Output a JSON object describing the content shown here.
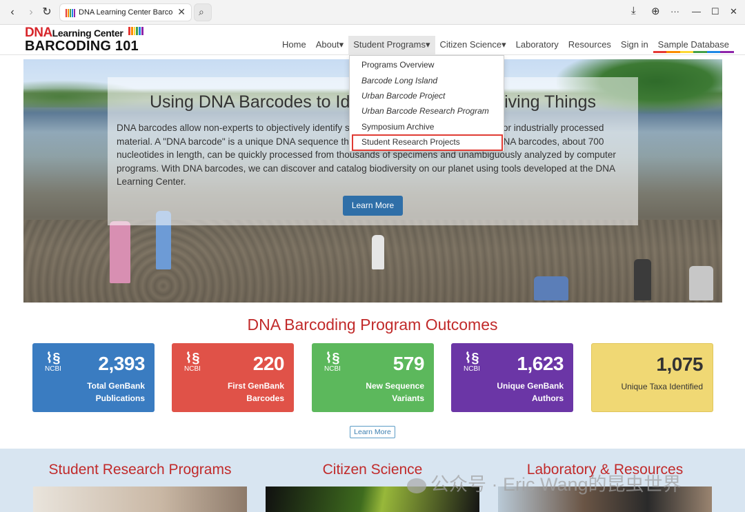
{
  "browser": {
    "tab_title": "DNA Learning Center Barco",
    "close_glyph": "✕",
    "back_glyph": "‹",
    "forward_glyph": "›",
    "reload_glyph": "↻",
    "search_glyph": "⌕",
    "download_glyph": "⤓",
    "globe_glyph": "⊕",
    "more_glyph": "···",
    "minimize_glyph": "—",
    "maximize_glyph": "☐",
    "window_close_glyph": "✕"
  },
  "logo": {
    "top": "DNA",
    "top_sub": "Learning Center",
    "bottom": "BARCODING 101",
    "bar_colors": [
      "#e53935",
      "#fb8c00",
      "#fdd835",
      "#43a047",
      "#1e88e5",
      "#8e24aa"
    ]
  },
  "nav": {
    "items": [
      {
        "label": "Home"
      },
      {
        "label": "About▾"
      },
      {
        "label": "Student Programs▾"
      },
      {
        "label": "Citizen Science▾"
      },
      {
        "label": "Laboratory"
      },
      {
        "label": "Resources"
      },
      {
        "label": "Sign in"
      },
      {
        "label": "Sample Database"
      }
    ]
  },
  "dropdown": {
    "items": [
      {
        "label": "Programs Overview",
        "italic": false
      },
      {
        "label": "Barcode Long Island",
        "italic": true
      },
      {
        "label": "Urban Barcode Project",
        "italic": true
      },
      {
        "label": "Urban Barcode Research Program",
        "italic": true
      },
      {
        "label": "Symposium Archive",
        "italic": false
      },
      {
        "label": "Student Research Projects",
        "italic": false
      }
    ],
    "highlight_color": "#e03b33"
  },
  "hero": {
    "title": "Using DNA Barcodes to Identify and Classify Living Things",
    "text": "DNA barcodes allow non-experts to objectively identify species – even from small, damaged, or industrially processed material. A \"DNA barcode\" is a unique DNA sequence that identifies each living thing. Short DNA barcodes, about 700 nucleotides in length, can be quickly processed from thousands of specimens and unambiguously analyzed by computer programs. With DNA barcodes, we can discover and catalog biodiversity on our planet using tools developed at the DNA Learning Center.",
    "button": "Learn More"
  },
  "outcomes": {
    "title": "DNA Barcoding Program Outcomes",
    "stats": [
      {
        "number": "2,393",
        "caption": "Total GenBank Publications",
        "color": "#3a7cc1",
        "ncbi": "NCBI",
        "helix": "⌇§"
      },
      {
        "number": "220",
        "caption": "First GenBank Barcodes",
        "color": "#e05248",
        "ncbi": "NCBI",
        "helix": "⌇§"
      },
      {
        "number": "579",
        "caption": "New Sequence Variants",
        "color": "#5cb85c",
        "ncbi": "NCBI",
        "helix": "⌇§"
      },
      {
        "number": "1,623",
        "caption": "Unique GenBank Authors",
        "color": "#6b36a6",
        "ncbi": "NCBI",
        "helix": "⌇§"
      },
      {
        "number": "1,075",
        "caption": "Unique Taxa Identified",
        "color": "#f0d874",
        "ncbi": "",
        "helix": ""
      }
    ],
    "learn_more": "Learn More"
  },
  "sections": [
    {
      "title": "Student Research Programs"
    },
    {
      "title": "Citizen Science"
    },
    {
      "title": "Laboratory & Resources"
    }
  ],
  "watermark": "公众号 · Eric Wang的昆虫世界"
}
